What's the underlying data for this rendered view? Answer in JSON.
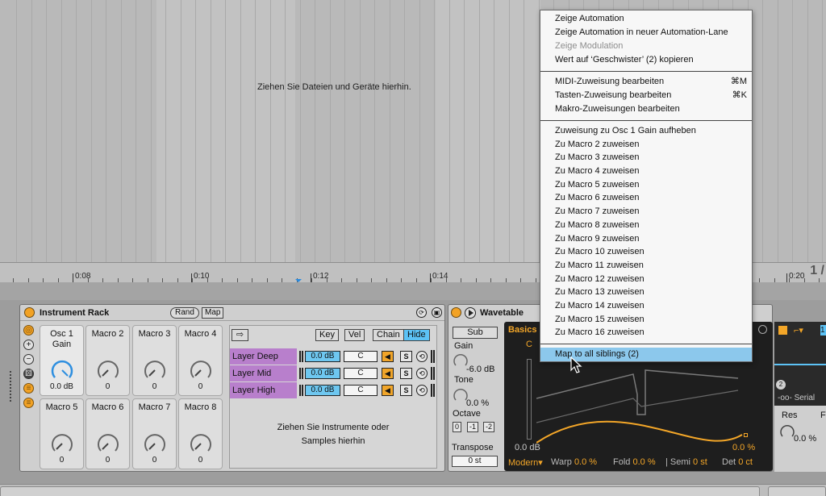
{
  "arrangement": {
    "drop_hint": "Ziehen Sie Dateien und Geräte hierhin.",
    "timeline_labels": [
      "0:08",
      "0:10",
      "0:12",
      "0:14",
      "0:20"
    ],
    "corner_label": "1 /"
  },
  "instrument_rack": {
    "title": "Instrument Rack",
    "rand_label": "Rand",
    "map_label": "Map",
    "macros": [
      {
        "label": "Osc 1\nGain",
        "value": "0.0 dB"
      },
      {
        "label": "Macro 2",
        "value": "0"
      },
      {
        "label": "Macro 3",
        "value": "0"
      },
      {
        "label": "Macro 4",
        "value": "0"
      },
      {
        "label": "Macro 5",
        "value": "0"
      },
      {
        "label": "Macro 6",
        "value": "0"
      },
      {
        "label": "Macro 7",
        "value": "0"
      },
      {
        "label": "Macro 8",
        "value": "0"
      }
    ],
    "chain_header": {
      "key": "Key",
      "vel": "Vel",
      "chain": "Chain",
      "hide": "Hide"
    },
    "chains": [
      {
        "name": "Layer Deep",
        "volume": "0.0 dB",
        "pan": "C",
        "solo": "S"
      },
      {
        "name": "Layer Mid",
        "volume": "0.0 dB",
        "pan": "C",
        "solo": "S"
      },
      {
        "name": "Layer High",
        "volume": "0.0 dB",
        "pan": "C",
        "solo": "S"
      }
    ],
    "chain_drop_hint_1": "Ziehen Sie Instrumente oder",
    "chain_drop_hint_2": "Samples hierhin"
  },
  "wavetable": {
    "title": "Wavetable",
    "sub_label": "Sub",
    "gain_label": "Gain",
    "gain_value": "-6.0 dB",
    "tone_label": "Tone",
    "tone_value": "0.0 %",
    "octave_label": "Octave",
    "octave_options": [
      "0",
      "-1",
      "-2"
    ],
    "transpose_label": "Transpose",
    "transpose_value": "0 st",
    "tab_basics": "Basics",
    "note_label": "C",
    "osc_gain_value": "0.0 dB",
    "right_value": "0.0 %",
    "mode": "Modern",
    "warp_label": "Warp",
    "warp_value": "0.0 %",
    "fold_label": "Fold",
    "fold_value": "0.0 %",
    "semi_label": "Semi",
    "semi_value": "0 st",
    "det_label": "Det",
    "det_value": "0 ct",
    "accent_color": "#f3a628"
  },
  "filter": {
    "badge": "2",
    "serial_label": "Serial",
    "res_label": "Res",
    "res_value": "0.0 %",
    "f_label": "F",
    "top_num": "1"
  },
  "context_menu": {
    "items": [
      {
        "label": "Zeige Automation",
        "disabled": false
      },
      {
        "label": "Zeige Automation in neuer Automation-Lane",
        "disabled": false
      },
      {
        "label": "Zeige Modulation",
        "disabled": true
      },
      {
        "label": "Wert auf ‘Geschwister’ (2) kopieren",
        "disabled": false
      },
      {
        "label": "MIDI-Zuweisung bearbeiten",
        "shortcut": "⌘M"
      },
      {
        "label": "Tasten-Zuweisung bearbeiten",
        "shortcut": "⌘K"
      },
      {
        "label": "Makro-Zuweisungen bearbeiten"
      },
      {
        "label": "Zuweisung zu Osc 1 Gain aufheben"
      },
      {
        "label": "Zu Macro 2 zuweisen"
      },
      {
        "label": "Zu Macro 3 zuweisen"
      },
      {
        "label": "Zu Macro 4 zuweisen"
      },
      {
        "label": "Zu Macro 5 zuweisen"
      },
      {
        "label": "Zu Macro 6 zuweisen"
      },
      {
        "label": "Zu Macro 7 zuweisen"
      },
      {
        "label": "Zu Macro 8 zuweisen"
      },
      {
        "label": "Zu Macro 9 zuweisen"
      },
      {
        "label": "Zu Macro 10 zuweisen"
      },
      {
        "label": "Zu Macro 11 zuweisen"
      },
      {
        "label": "Zu Macro 12 zuweisen"
      },
      {
        "label": "Zu Macro 13 zuweisen"
      },
      {
        "label": "Zu Macro 14 zuweisen"
      },
      {
        "label": "Zu Macro 15 zuweisen"
      },
      {
        "label": "Zu Macro 16 zuweisen"
      },
      {
        "label": "Map to all siblings (2)",
        "highlighted": true
      }
    ]
  }
}
